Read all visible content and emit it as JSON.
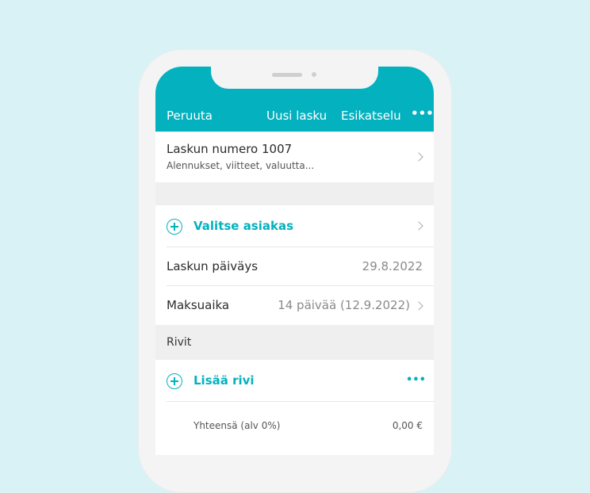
{
  "header": {
    "cancel_label": "Peruuta",
    "title": "Uusi lasku",
    "preview_label": "Esikatselu",
    "more_label": "•••"
  },
  "invoice": {
    "number_label": "Laskun numero 1007",
    "options_label": "Alennukset, viitteet, valuutta..."
  },
  "customer": {
    "select_label": "Valitse asiakas"
  },
  "invoice_date": {
    "label": "Laskun päiväys",
    "value": "29.8.2022"
  },
  "payment_term": {
    "label": "Maksuaika",
    "value": "14 päivää (12.9.2022)"
  },
  "rows_section": {
    "title": "Rivit",
    "add_label": "Lisää rivi",
    "more_label": "•••"
  },
  "totals": {
    "label": "Yhteensä (alv 0%)",
    "value": "0,00 €"
  },
  "colors": {
    "accent": "#04b1bf",
    "background": "#d8f2f6"
  }
}
